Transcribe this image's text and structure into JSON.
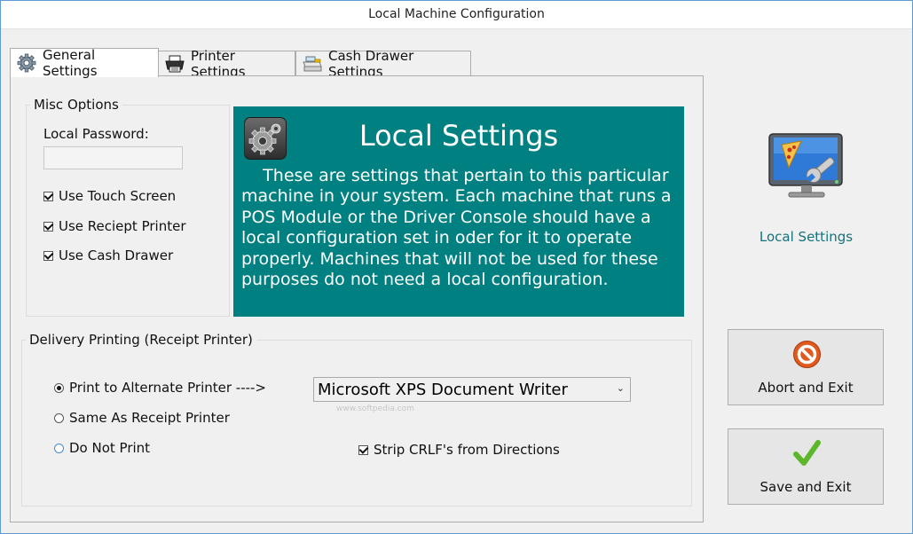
{
  "window": {
    "title": "Local Machine Configuration"
  },
  "tabs": [
    {
      "label": "General Settings",
      "icon": "gear-icon",
      "active": true
    },
    {
      "label": "Printer Settings",
      "icon": "printer-icon",
      "active": false
    },
    {
      "label": "Cash Drawer Settings",
      "icon": "cash-register-icon",
      "active": false
    }
  ],
  "misc": {
    "title": "Misc Options",
    "password_label": "Local Password:",
    "password_value": "",
    "checks": [
      {
        "label": "Use Touch Screen",
        "checked": true
      },
      {
        "label": "Use Reciept Printer",
        "checked": true
      },
      {
        "label": "Use Cash Drawer",
        "checked": true
      }
    ]
  },
  "info": {
    "title": "Local Settings",
    "text": "These are settings that pertain to this particular machine in your system.  Each machine that runs a POS Module or the Driver Console should have a local configuration set in oder for it to operate properly.  Machines that will not be used for these purposes do not need a local configuration.",
    "color": "#008080"
  },
  "delivery": {
    "title": "Delivery Printing (Receipt Printer)",
    "options": [
      {
        "label": "Print to Alternate Printer ---->",
        "selected": true
      },
      {
        "label": "Same As Receipt Printer",
        "selected": false
      },
      {
        "label": "Do Not Print",
        "selected": false
      }
    ],
    "printer_value": "Microsoft XPS Document Writer",
    "strip_label": "Strip CRLF's from Directions",
    "strip_checked": true
  },
  "sidebar": {
    "label": "Local Settings",
    "icon": "pos-settings-icon",
    "abort_label": "Abort and Exit",
    "save_label": "Save and Exit"
  },
  "watermark": "www.softpedia.com"
}
